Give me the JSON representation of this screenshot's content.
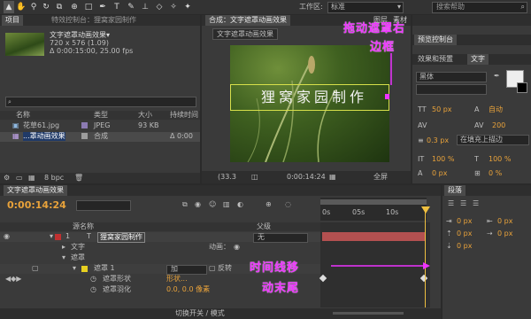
{
  "toolbar": {
    "workspace_label": "工作区:",
    "workspace_value": "标准",
    "search_placeholder": "搜索帮助"
  },
  "project": {
    "tab": "项目",
    "effects_tab": "特效控制台：狸窝家园制作",
    "comp_name": "文字遮罩动画效果▾",
    "comp_info1": "720 x 576 (1.09)",
    "comp_info2": "Δ 0:00:15:00, 25.00 fps",
    "search_icon": "🔍",
    "col_name": "名称",
    "col_type": "类型",
    "col_size": "大小",
    "col_duration": "持续时间",
    "rows": [
      {
        "name": "花草61.jpg",
        "type": "JPEG",
        "size": "93 KB",
        "duration": ""
      },
      {
        "name": "...罩动画效果",
        "type": "合成",
        "size": "",
        "duration": "Δ 0:00"
      }
    ],
    "bpc": "8 bpc"
  },
  "viewer": {
    "comp_tab": "合成：文字遮罩动画效果",
    "layer_tab": "图层",
    "footage_tab": "素材",
    "comp_label": "文字遮罩动画效果",
    "title_text": "狸窝家园制作",
    "zoom": "(33.3",
    "time": "0:00:14:24",
    "view": "全屏"
  },
  "right_panels": {
    "preview_tab": "预览控制台",
    "effects_tab": "效果和预置",
    "text_tab": "文字",
    "font": "黑体",
    "font_size": "50 px",
    "leading": "自动",
    "tracking": "200",
    "stroke_width": "0.3 px",
    "stroke_mode": "在填充上描边",
    "scale_v": "100 %",
    "scale_h": "100 %",
    "baseline": "0 px",
    "tsume": "0 %",
    "paragraph_tab": "段落",
    "para_values": [
      "0 px",
      "0 px",
      "0 px",
      "0 px",
      "0 px"
    ],
    "t_icon": "T"
  },
  "timeline": {
    "tab": "文字遮罩动画效果",
    "timecode": "0:00:14:24",
    "col_layer_name": "源名称",
    "col_parent": "父级",
    "ruler": [
      "0s",
      "05s",
      "10s"
    ],
    "layer_num": "1",
    "layer_name": "狸窝家园制作",
    "parent_value": "无",
    "text_row": "文字",
    "animate_label": "动画：",
    "masks_row": "遮罩",
    "mask1": "遮罩 1",
    "mask_mode": "加",
    "mask_invert": "反转",
    "mask_shape": "遮罩形状",
    "mask_shape_value": "形状...",
    "mask_feather": "遮罩羽化",
    "mask_feather_value": "0.0, 0.0 像素",
    "switch_mode": "切换开关 / 模式"
  },
  "annotations": {
    "drag_right": "拖动遮罩右",
    "drag_right2": "边框",
    "timeline_move": "时间线移",
    "timeline_move2": "动末尾"
  },
  "colors": {
    "accent_orange": "#e8a23a",
    "annotation_magenta": "#ee33ff",
    "layer_red": "#c03030",
    "mask_yellow": "#e8d020",
    "playhead": "#f0c040"
  }
}
